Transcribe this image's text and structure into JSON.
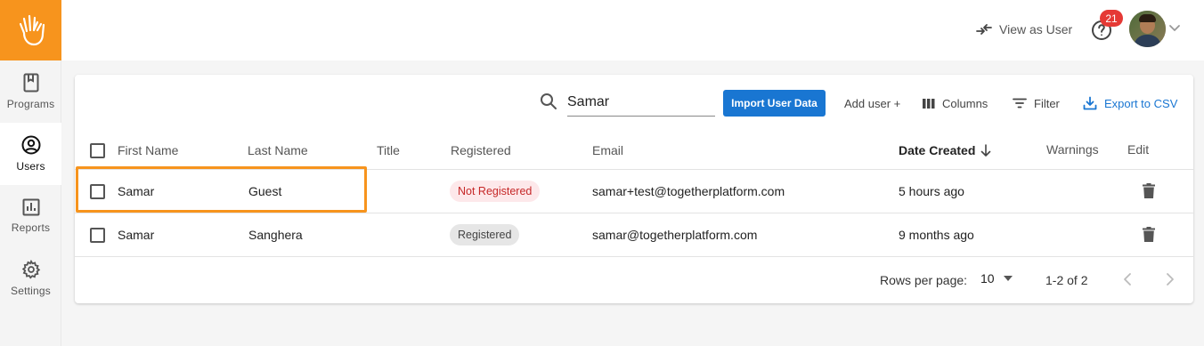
{
  "colors": {
    "brand_orange": "#f7941d",
    "primary_blue": "#1976d2",
    "badge_red": "#e53935",
    "chip_red_bg": "#fde8ea",
    "chip_red_text": "#c62828",
    "chip_grey_bg": "#e6e6e6"
  },
  "sidebar": {
    "logo_icon": "raised-hand-icon",
    "items": [
      {
        "label": "Programs",
        "icon": "book-icon",
        "active": false
      },
      {
        "label": "Users",
        "icon": "user-circle-icon",
        "active": true
      },
      {
        "label": "Reports",
        "icon": "bar-chart-icon",
        "active": false
      },
      {
        "label": "Settings",
        "icon": "gear-icon",
        "active": false
      }
    ]
  },
  "header": {
    "view_as_label": "View as User",
    "view_as_icon": "swap-arrows-icon",
    "help_icon": "help-circle-icon",
    "notification_count": "21",
    "avatar_caret_icon": "chevron-down-icon"
  },
  "toolbar": {
    "search_value": "Samar",
    "import_label": "Import User Data",
    "add_user_label": "Add user +",
    "columns_label": "Columns",
    "filter_label": "Filter",
    "export_label": "Export to CSV"
  },
  "table": {
    "headers": {
      "first_name": "First Name",
      "last_name": "Last Name",
      "title": "Title",
      "registered": "Registered",
      "email": "Email",
      "date_created": "Date Created",
      "warnings": "Warnings",
      "edit": "Edit"
    },
    "sort": {
      "column": "date_created",
      "direction": "descending"
    },
    "rows": [
      {
        "first_name": "Samar",
        "last_name": "Guest",
        "title": "",
        "registered": "Not Registered",
        "registered_status": "not-registered",
        "email": "samar+test@togetherplatform.com",
        "date_created": "5 hours ago",
        "warnings": "",
        "highlighted": true
      },
      {
        "first_name": "Samar",
        "last_name": "Sanghera",
        "title": "",
        "registered": "Registered",
        "registered_status": "registered",
        "email": "samar@togetherplatform.com",
        "date_created": "9 months ago",
        "warnings": "",
        "highlighted": false
      }
    ]
  },
  "pagination": {
    "rows_per_page_label": "Rows per page:",
    "rows_per_page_value": "10",
    "range_label": "1-2 of 2"
  }
}
